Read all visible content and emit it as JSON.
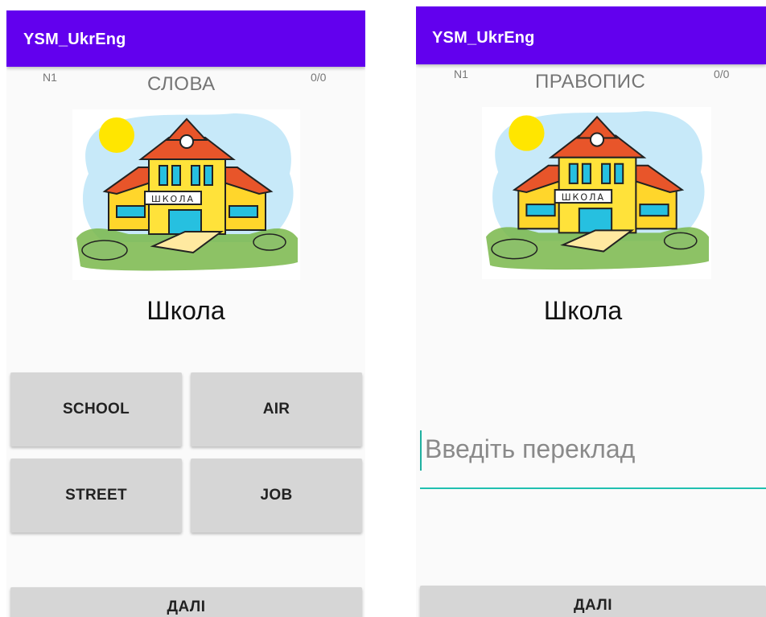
{
  "left_screen": {
    "app_title": "YSM_UkrEng",
    "counter": "N1",
    "mode_title": "СЛОВА",
    "score": "0/0",
    "image_sign": "ШКОЛА",
    "word": "Школа",
    "answers": [
      "SCHOOL",
      "AIR",
      "STREET",
      "JOB"
    ],
    "next_label": "ДАЛІ"
  },
  "right_screen": {
    "app_title": "YSM_UkrEng",
    "counter": "N1",
    "mode_title": "ПРАВОПИС",
    "score": "0/0",
    "image_sign": "ШКОЛА",
    "word": "Школа",
    "input_placeholder": "Введіть переклад",
    "input_value": "",
    "next_label": "ДАЛІ"
  },
  "colors": {
    "appbar": "#6200ee",
    "button": "#d6d6d6",
    "input_underline": "#20c0b0"
  },
  "icons": [
    "school-building-illustration"
  ]
}
